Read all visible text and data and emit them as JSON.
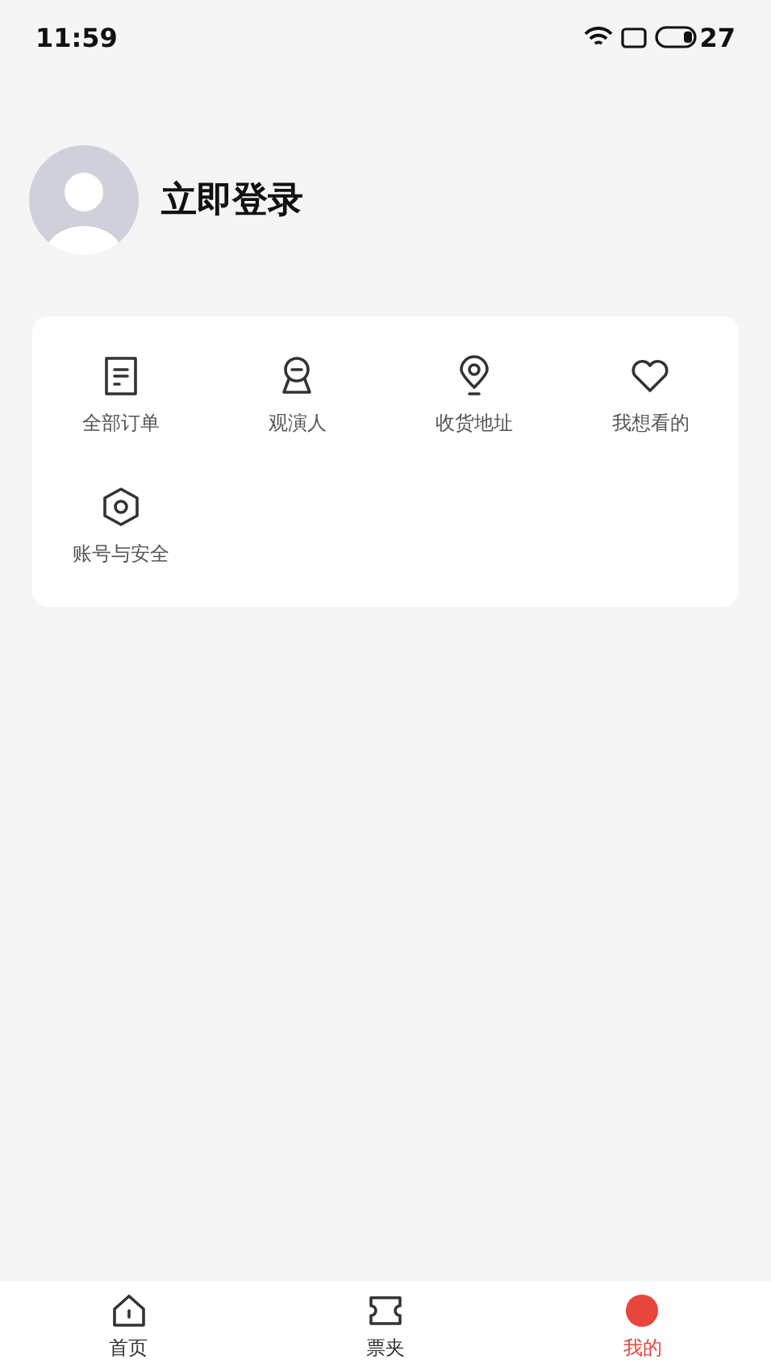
{
  "status_bar": {
    "time": "11:59",
    "battery": "27"
  },
  "profile": {
    "login": "立即登录"
  },
  "menu": [
    {
      "kind": "orders",
      "label": "全部订单"
    },
    {
      "kind": "audience",
      "label": "观演人"
    },
    {
      "kind": "address",
      "label": "收货地址"
    },
    {
      "kind": "wish",
      "label": "我想看的"
    },
    {
      "kind": "security",
      "label": "账号与安全"
    }
  ],
  "tab_bar": [
    {
      "kind": "home",
      "label": "首页",
      "selected": false
    },
    {
      "kind": "ticket",
      "label": "票夹",
      "selected": false
    },
    {
      "kind": "mine",
      "label": "我的",
      "selected": true
    }
  ]
}
